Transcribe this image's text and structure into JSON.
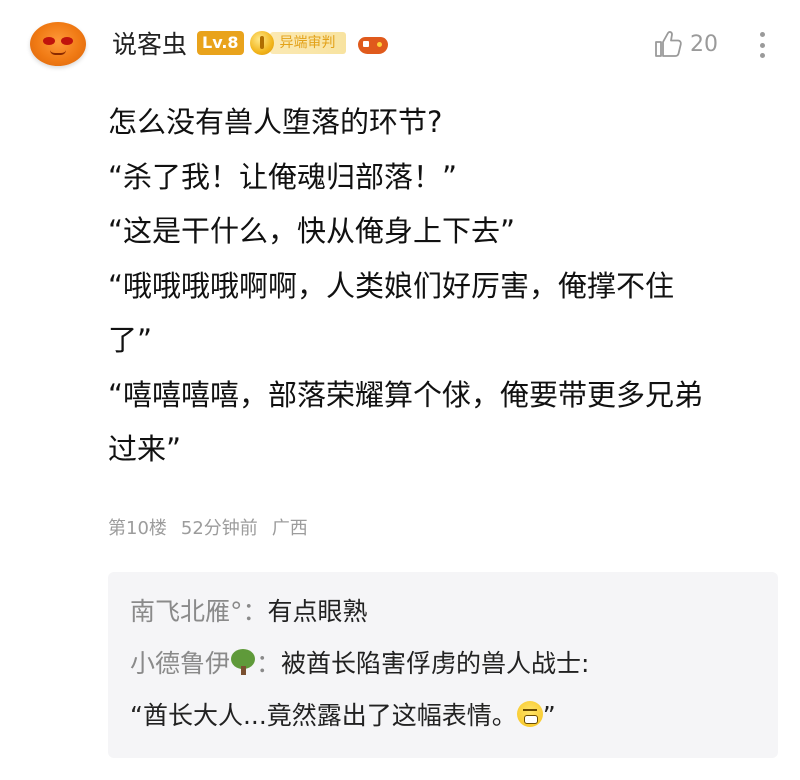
{
  "user": {
    "name": "说客虫",
    "level": "Lv.8",
    "medal_label": "异端审判"
  },
  "likes": {
    "count": "20"
  },
  "comment": {
    "lines": [
      "怎么没有兽人堕落的环节?",
      "“杀了我！让俺魂归部落！”",
      "“这是干什么，快从俺身上下去”",
      "“哦哦哦哦啊啊，人类娘们好厉害，俺撑不住",
      "了”",
      "“嘻嘻嘻嘻，部落荣耀算个俅，俺要带更多兄弟",
      "过来”"
    ]
  },
  "meta": {
    "floor": "第10楼",
    "time": "52分钟前",
    "location": "广西"
  },
  "replies": [
    {
      "name": "南飞北雁°",
      "text": "有点眼熟"
    },
    {
      "name": "小德鲁伊",
      "text": "被酋长陷害俘虏的兽人战士:",
      "continuation": "“酋长大人...竟然露出了这幅表情。",
      "continuation_end": "”"
    }
  ],
  "icons": {
    "like": "thumbs-up-icon",
    "more": "more-vertical-icon",
    "medal": "medal-gem-icon",
    "game": "gamepad-icon",
    "tree": "tree-icon",
    "emoji": "grimace-emoji-icon"
  },
  "colors": {
    "level_badge": "#e9a31c",
    "medal_text": "#e3a21a",
    "meta_text": "#9c9c9c",
    "reply_bg": "#f5f5f7"
  }
}
